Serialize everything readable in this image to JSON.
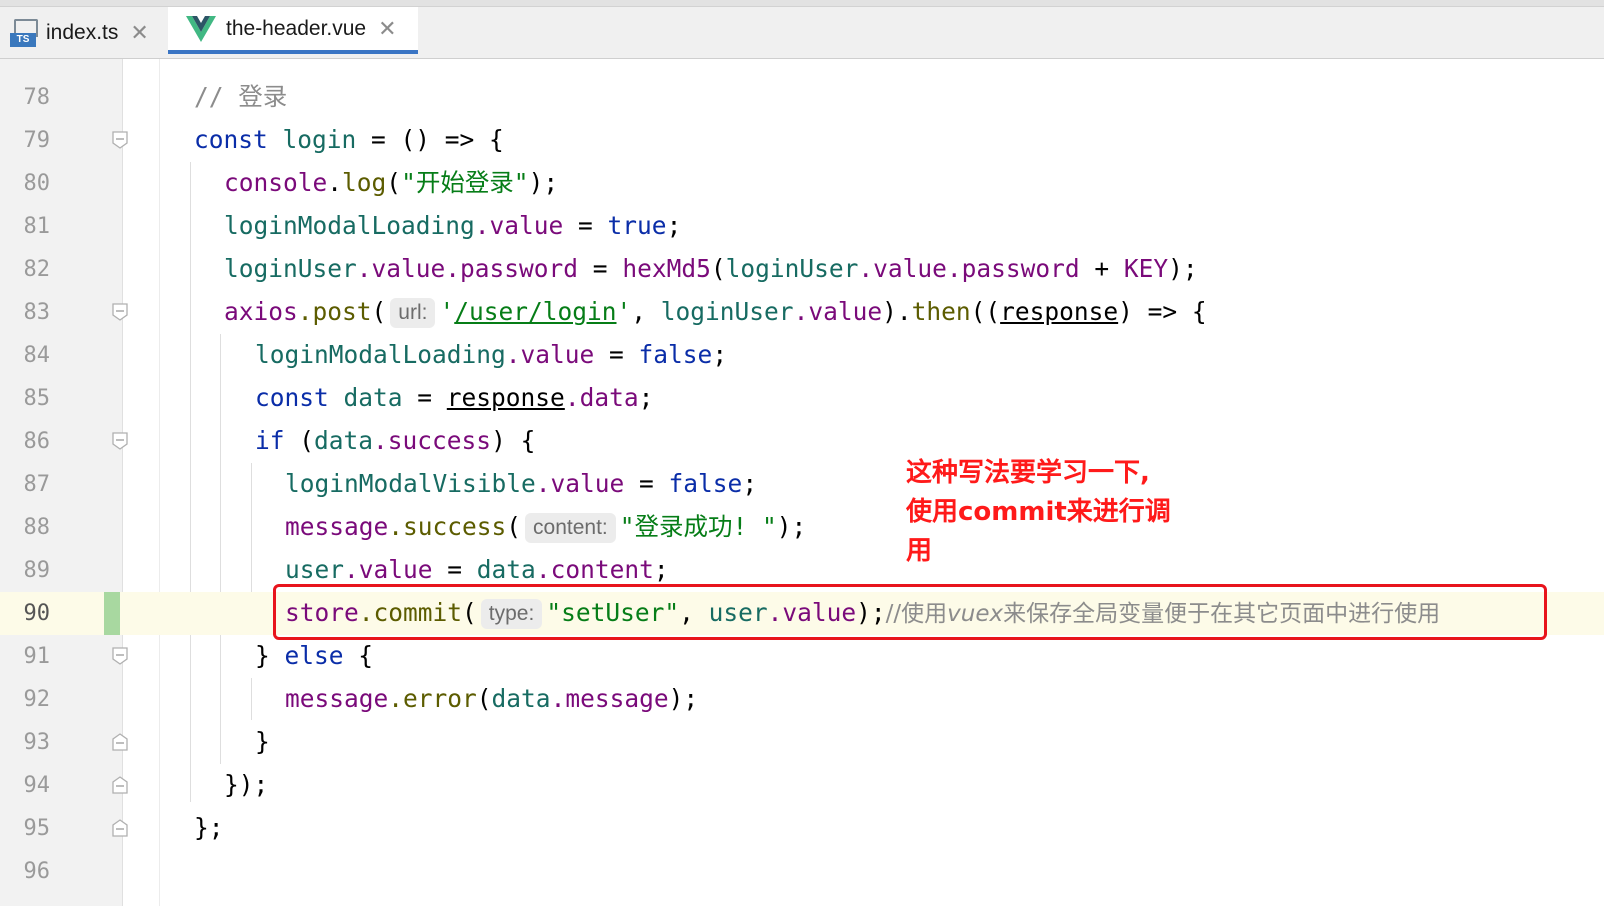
{
  "tabs": [
    {
      "label": "index.ts",
      "icon": "typescript-file-icon",
      "active": false
    },
    {
      "label": "the-header.vue",
      "icon": "vue-file-icon",
      "active": true
    }
  ],
  "ts_badge": "TS",
  "lines": [
    {
      "n": "78"
    },
    {
      "n": "79"
    },
    {
      "n": "80"
    },
    {
      "n": "81"
    },
    {
      "n": "82"
    },
    {
      "n": "83"
    },
    {
      "n": "84"
    },
    {
      "n": "85"
    },
    {
      "n": "86"
    },
    {
      "n": "87"
    },
    {
      "n": "88"
    },
    {
      "n": "89"
    },
    {
      "n": "90"
    },
    {
      "n": "91"
    },
    {
      "n": "92"
    },
    {
      "n": "93"
    },
    {
      "n": "94"
    },
    {
      "n": "95"
    },
    {
      "n": "96"
    }
  ],
  "code": {
    "l78": {
      "comment": "// 登录"
    },
    "l79": {
      "kw": "const",
      "name": "login",
      "rest": " = () => {"
    },
    "l80": {
      "obj": "console",
      "dot": ".",
      "fn": "log",
      "open": "(",
      "str": "\"开始登录\"",
      "close": ");"
    },
    "l81": {
      "var": "loginModalLoading",
      "prop": ".value",
      "eq": " = ",
      "lit": "true",
      "end": ";"
    },
    "l82": {
      "var": "loginUser",
      "prop1": ".value",
      "prop2": ".password",
      "eq": " = ",
      "fn": "hexMd5",
      "open": "(",
      "var2": "loginUser",
      "prop3": ".value",
      "prop4": ".password",
      "plus": " + ",
      "const": "KEY",
      "end": ");"
    },
    "l83": {
      "obj": "axios",
      "fn": ".post",
      "open": "(",
      "hint": "url:",
      "q1": "'",
      "str": "/user/login",
      "q2": "'",
      "comma": ", ",
      "var": "loginUser",
      "prop": ".value",
      "mid": ").",
      "then": "then",
      "open2": "((",
      "param": "response",
      "arrow": ") => {"
    },
    "l84": {
      "var": "loginModalLoading",
      "prop": ".value",
      "eq": " = ",
      "lit": "false",
      "end": ";"
    },
    "l85": {
      "kw": "const",
      "name": " data",
      "eq": " = ",
      "param": "response",
      "prop": ".data",
      "end": ";"
    },
    "l86": {
      "kw": "if",
      "open": " (",
      "var": "data",
      "prop": ".success",
      "close": ") {"
    },
    "l87": {
      "var": "loginModalVisible",
      "prop": ".value",
      "eq": " = ",
      "lit": "false",
      "end": ";"
    },
    "l88": {
      "obj": "message",
      "fn": ".success",
      "open": "(",
      "hint": "content:",
      "str": "\"登录成功! \"",
      "close": ");"
    },
    "l89": {
      "var": "user",
      "prop": ".value",
      "eq": " = ",
      "var2": "data",
      "prop2": ".content",
      "end": ";"
    },
    "l90": {
      "obj": "store",
      "fn": ".commit",
      "open": "(",
      "hint": "type:",
      "str": "\"setUser\"",
      "comma": ", ",
      "var": "user",
      "prop": ".value",
      "close": ");",
      "cmt1": "//使用",
      "cmt_i": "vuex",
      "cmt2": "来保存全局变量便于在其它页面中进行使用"
    },
    "l91": {
      "close": "} ",
      "kw": "else",
      "open": " {"
    },
    "l92": {
      "obj": "message",
      "fn": ".error",
      "open": "(",
      "var": "data",
      "prop": ".message",
      "close": ");"
    },
    "l93": {
      "text": "}"
    },
    "l94": {
      "text": "});"
    },
    "l95": {
      "text": "};"
    }
  },
  "annotation": {
    "line1": "这种写法要学习一下,",
    "line2": "使用commit来进行调",
    "line3": "用"
  },
  "colors": {
    "keyword": "#0a2da8",
    "string": "#067d17",
    "property": "#7a0a7a",
    "variable": "#176b62",
    "highlight_box": "#e8141c",
    "annotation_text": "#ff1a1a"
  }
}
